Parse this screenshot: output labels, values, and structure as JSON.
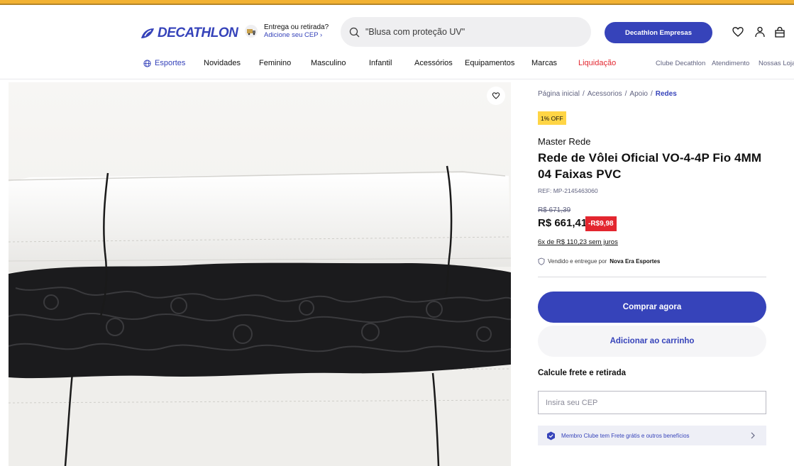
{
  "colors": {
    "brand": "#3643ba",
    "sale": "#e3262f",
    "badge": "#ffd545",
    "stripe": "#f2b233"
  },
  "header": {
    "logo_text": "DECATHLON",
    "delivery": {
      "title": "Entrega ou retirada?",
      "link": "Adicione seu CEP"
    },
    "search": {
      "placeholder": "\"Blusa com proteção UV\""
    },
    "empresas_label": "Decathlon Empresas",
    "icons": [
      "heart-icon",
      "user-icon",
      "bag-icon"
    ]
  },
  "nav": {
    "items": [
      "Esportes",
      "Novidades",
      "Feminino",
      "Masculino",
      "Infantil",
      "Acessórios",
      "Equipamentos",
      "Marcas",
      "Liquidação"
    ],
    "secondary": [
      "Clube Decathlon",
      "Atendimento",
      "Nossas Lojas"
    ]
  },
  "breadcrumb": [
    "Página inicial",
    "Acessorios",
    "Apoio",
    "Redes"
  ],
  "product": {
    "badge": "1% OFF",
    "brand": "Master Rede",
    "title": "Rede de Vôlei Oficial VO-4-4P Fio 4MM 04 Faixas PVC",
    "ref": "REF: MP-2145463060",
    "old_price": "R$ 671,39",
    "price": "R$ 661,41",
    "discount": "-R$9,98",
    "installments": "6x de R$ 110,23 sem juros",
    "seller_prefix": "Vendido e entregue por",
    "seller_name": "Nova Era Esportes"
  },
  "actions": {
    "buy": "Comprar agora",
    "cart": "Adicionar ao carrinho"
  },
  "shipping": {
    "title": "Calcule frete e retirada",
    "cep_placeholder": "Insira seu CEP",
    "club_text": "Membro Clube tem Frete grátis e outros benefícios"
  }
}
